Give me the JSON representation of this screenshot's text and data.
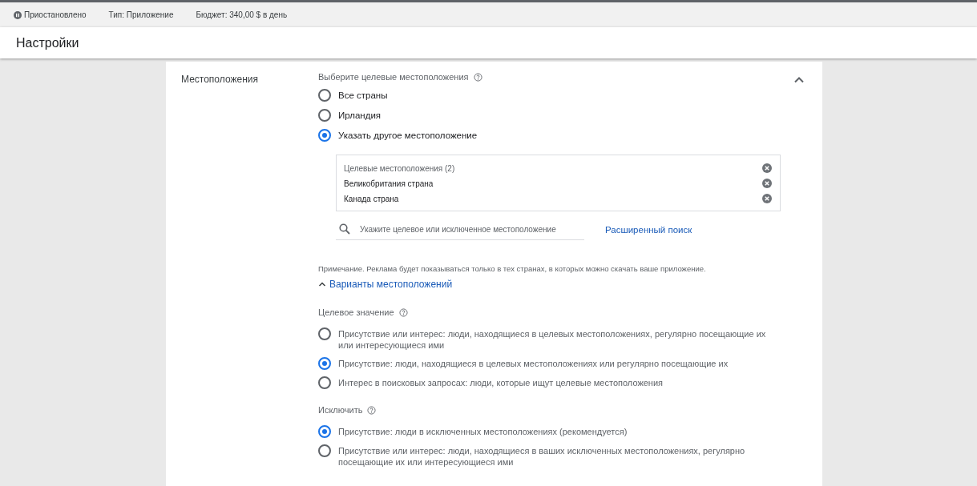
{
  "status_bar": {
    "status": "Приостановлено",
    "type": "Тип: Приложение",
    "budget": "Бюджет: 340,00 $ в день"
  },
  "header": {
    "title": "Настройки"
  },
  "section": {
    "label": "Местоположения",
    "expanded": true,
    "target_prompt": "Выберите целевые местоположения",
    "location_options": [
      {
        "label": "Все страны",
        "selected": false
      },
      {
        "label": "Ирландия",
        "selected": false
      },
      {
        "label": "Указать другое местоположение",
        "selected": true
      }
    ],
    "targeted": {
      "heading": "Целевые местоположения (2)",
      "items": [
        "Великобритания страна",
        "Канада страна"
      ]
    },
    "search": {
      "placeholder": "Укажите целевое или исключенное местоположение"
    },
    "advanced_search": "Расширенный поиск",
    "note": "Примечание. Реклама будет показываться только в тех странах, в которых можно скачать ваше приложение.",
    "options_toggle": {
      "label": "Варианты местоположений",
      "expanded": true
    },
    "target_heading": "Целевое значение",
    "target_options": [
      {
        "label": "Присутствие или интерес: люди, находящиеся в целевых местоположениях, регулярно посещающие их или интересующиеся ими",
        "selected": false
      },
      {
        "label": "Присутствие: люди, находящиеся в целевых местоположениях или регулярно посещающие их",
        "selected": true
      },
      {
        "label": "Интерес в поисковых запросах: люди, которые ищут целевые местоположения",
        "selected": false
      }
    ],
    "exclude_heading": "Исключить",
    "exclude_options": [
      {
        "label": "Присутствие: люди в исключенных местоположениях (рекомендуется)",
        "selected": true
      },
      {
        "label": "Присутствие или интерес: люди, находящиеся в ваших исключенных местоположениях, регулярно посещающие их или интересующиеся ими",
        "selected": false
      }
    ]
  }
}
